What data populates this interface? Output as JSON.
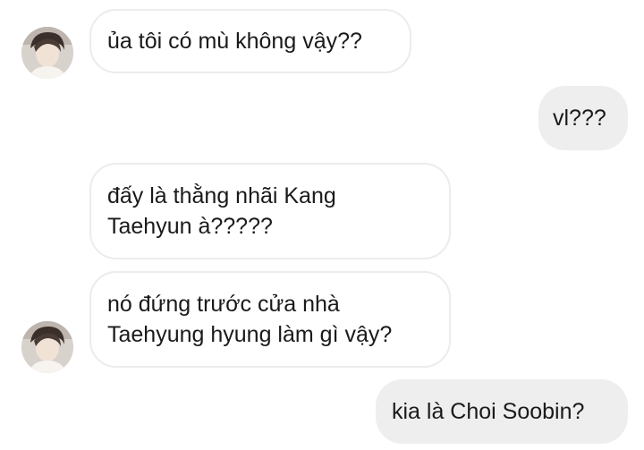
{
  "contact": {
    "avatar_icon": "profile-photo-avatar"
  },
  "messages": [
    {
      "direction": "incoming",
      "lines": [
        "ủa tôi có mù không vậy??"
      ]
    },
    {
      "direction": "outgoing",
      "lines": [
        "vl???"
      ]
    },
    {
      "direction": "incoming",
      "lines": [
        "đấy là thằng nhãi Kang",
        "Taehyun à?????"
      ]
    },
    {
      "direction": "incoming",
      "lines": [
        "nó đứng trước cửa nhà",
        "Taehyung hyung làm gì vậy?"
      ]
    },
    {
      "direction": "outgoing",
      "lines": [
        "kia là Choi Soobin?"
      ]
    }
  ],
  "colors": {
    "incoming_bubble": "#ffffff",
    "incoming_border": "#ececec",
    "outgoing_bubble": "#eeeeee",
    "text": "#1a1a1a"
  }
}
